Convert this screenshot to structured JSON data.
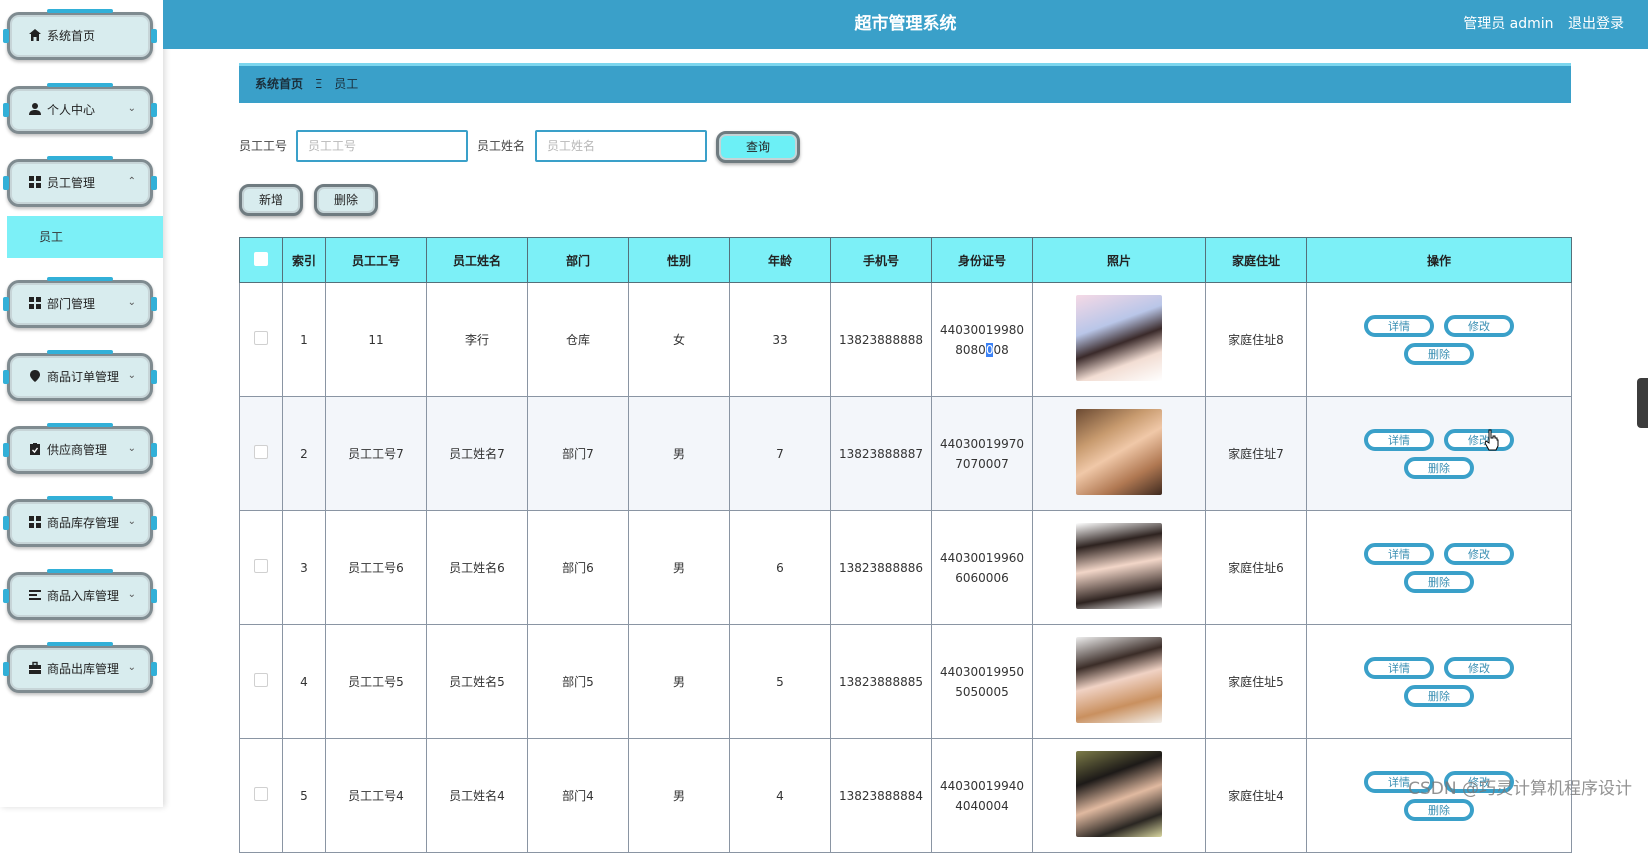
{
  "header": {
    "title": "超市管理系统",
    "user_label": "管理员 admin",
    "logout_label": "退出登录"
  },
  "sidebar": {
    "items": [
      {
        "label": "系统首页",
        "icon": "home-icon",
        "has_chevron": false
      },
      {
        "label": "个人中心",
        "icon": "user-icon",
        "has_chevron": true,
        "chevron": "⌄"
      },
      {
        "label": "员工管理",
        "icon": "grid-icon",
        "has_chevron": true,
        "chevron": "⌃"
      },
      {
        "label": "部门管理",
        "icon": "grid-icon",
        "has_chevron": true,
        "chevron": "⌄"
      },
      {
        "label": "商品订单管理",
        "icon": "map-pin-icon",
        "has_chevron": true,
        "chevron": "⌄"
      },
      {
        "label": "供应商管理",
        "icon": "clipboard-icon",
        "has_chevron": true,
        "chevron": "⌄"
      },
      {
        "label": "商品库存管理",
        "icon": "grid-icon",
        "has_chevron": true,
        "chevron": "⌄"
      },
      {
        "label": "商品入库管理",
        "icon": "list-icon",
        "has_chevron": true,
        "chevron": "⌄"
      },
      {
        "label": "商品出库管理",
        "icon": "briefcase-icon",
        "has_chevron": true,
        "chevron": "⌄"
      }
    ],
    "active_sub": "员工"
  },
  "breadcrumb": {
    "home": "系统首页",
    "separator": "Ξ",
    "current": "员工"
  },
  "search": {
    "no_label": "员工工号",
    "no_placeholder": "员工工号",
    "name_label": "员工姓名",
    "name_placeholder": "员工姓名",
    "query_label": "查询"
  },
  "actions": {
    "add_label": "新增",
    "delete_label": "删除"
  },
  "table": {
    "columns": [
      "索引",
      "员工工号",
      "员工姓名",
      "部门",
      "性别",
      "年龄",
      "手机号",
      "身份证号",
      "照片",
      "家庭住址",
      "操作"
    ],
    "rows": [
      {
        "index": "1",
        "no": "11",
        "name": "李行",
        "dept": "仓库",
        "gender": "女",
        "age": "33",
        "phone": "13823888888",
        "id_line1": "44030019980",
        "id_line2a": "8080",
        "id_line2b": "0",
        "id_line2c": "08",
        "address": "家庭住址8"
      },
      {
        "index": "2",
        "no": "员工工号7",
        "name": "员工姓名7",
        "dept": "部门7",
        "gender": "男",
        "age": "7",
        "phone": "13823888887",
        "id_line1": "44030019970",
        "id_line2a": "7070007",
        "id_line2b": "",
        "id_line2c": "",
        "address": "家庭住址7"
      },
      {
        "index": "3",
        "no": "员工工号6",
        "name": "员工姓名6",
        "dept": "部门6",
        "gender": "男",
        "age": "6",
        "phone": "13823888886",
        "id_line1": "44030019960",
        "id_line2a": "6060006",
        "id_line2b": "",
        "id_line2c": "",
        "address": "家庭住址6"
      },
      {
        "index": "4",
        "no": "员工工号5",
        "name": "员工姓名5",
        "dept": "部门5",
        "gender": "男",
        "age": "5",
        "phone": "13823888885",
        "id_line1": "44030019950",
        "id_line2a": "5050005",
        "id_line2b": "",
        "id_line2c": "",
        "address": "家庭住址5"
      },
      {
        "index": "5",
        "no": "员工工号4",
        "name": "员工姓名4",
        "dept": "部门4",
        "gender": "男",
        "age": "4",
        "phone": "13823888884",
        "id_line1": "44030019940",
        "id_line2a": "4040004",
        "id_line2b": "",
        "id_line2c": "",
        "address": "家庭住址4"
      }
    ],
    "row_actions": {
      "detail_label": "详情",
      "edit_label": "修改",
      "delete_label": "删除"
    }
  },
  "colors": {
    "header_bg": "#3aa0c9",
    "table_head_bg": "#7cf0f7",
    "menu_bg": "#d8ecee",
    "active_sub_bg": "#7cf0f7"
  },
  "watermark": "CSDN @巧灵计算机程序设计"
}
